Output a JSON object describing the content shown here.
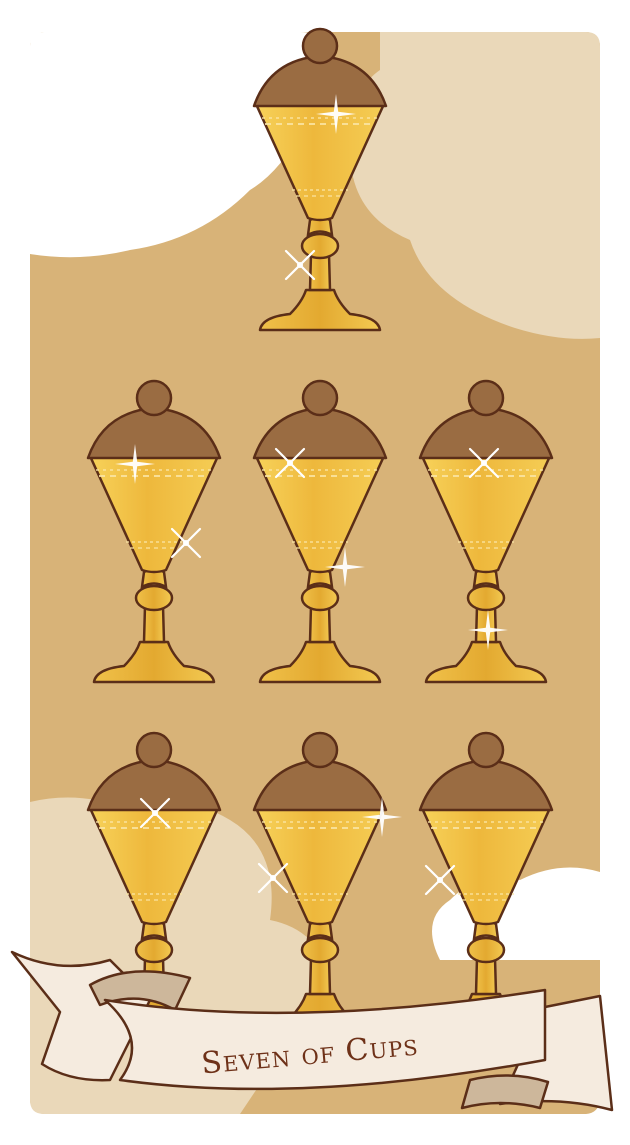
{
  "card": {
    "title": "Seven of Cups",
    "count": 7
  },
  "colors": {
    "background": "#d8b378",
    "cloud": "#ead8b9",
    "cup_gold": "#f0c54c",
    "cup_gold_dark": "#d59a23",
    "outline": "#5b2e18",
    "cup_top": "#9a6c42",
    "ribbon": "#f5ebdf",
    "ribbon_shadow": "#cdb79b",
    "title_color": "#6e3118"
  },
  "icons": {
    "cup": "goblet-icon",
    "sparkle": "sparkle-icon"
  }
}
